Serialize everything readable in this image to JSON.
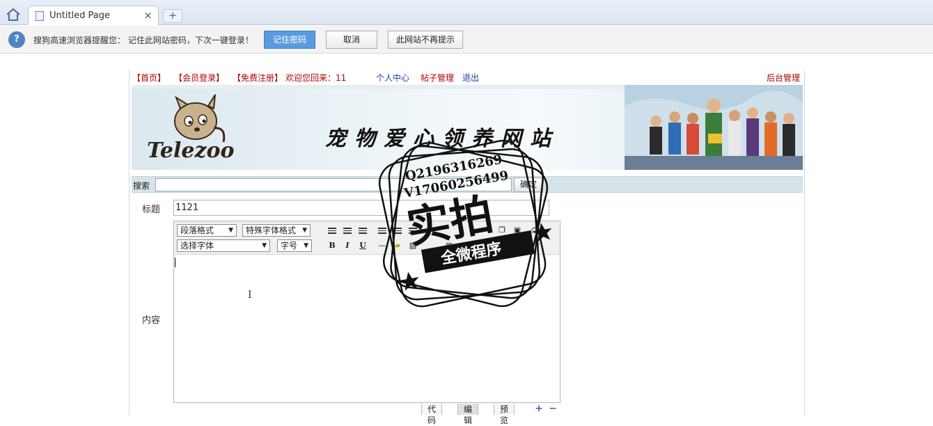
{
  "browser": {
    "tab_title": "Untitled Page",
    "tab_close": "×",
    "new_tab": "+",
    "notify": {
      "text": "搜狗高速浏览器提醒您： 记住此网站密码，下次一键登录！",
      "remember_label": "记住密码",
      "cancel_label": "取消",
      "never_label": "此网站不再提示"
    }
  },
  "nav": {
    "home": "【首页】",
    "login": "【会员登录】",
    "register": "【免费注册】",
    "welcome": "欢迎您回来：11",
    "profile": "个人中心",
    "posts": "帖子管理",
    "logout": "退出",
    "admin": "后台管理"
  },
  "banner": {
    "site_title": "宠物爱心领养网站",
    "logo_text": "Telezoo"
  },
  "search": {
    "label": "搜索",
    "value": "",
    "submit_label": "确定"
  },
  "form": {
    "title_label": "标题",
    "title_value": "1121",
    "content_label": "内容"
  },
  "editor": {
    "paragraph_format": "段落格式",
    "special_font": "特殊字体格式",
    "font_select": "选择字体",
    "font_size": "字号",
    "bold": "B",
    "italic": "I",
    "underline": "U",
    "modes": {
      "code": "代码",
      "edit": "编辑",
      "preview": "预览"
    },
    "active_mode": "edit"
  },
  "watermark": {
    "line1": "Q2196316269",
    "line2": "V17060256499",
    "big": "实拍",
    "ribbon": "全微程序"
  }
}
